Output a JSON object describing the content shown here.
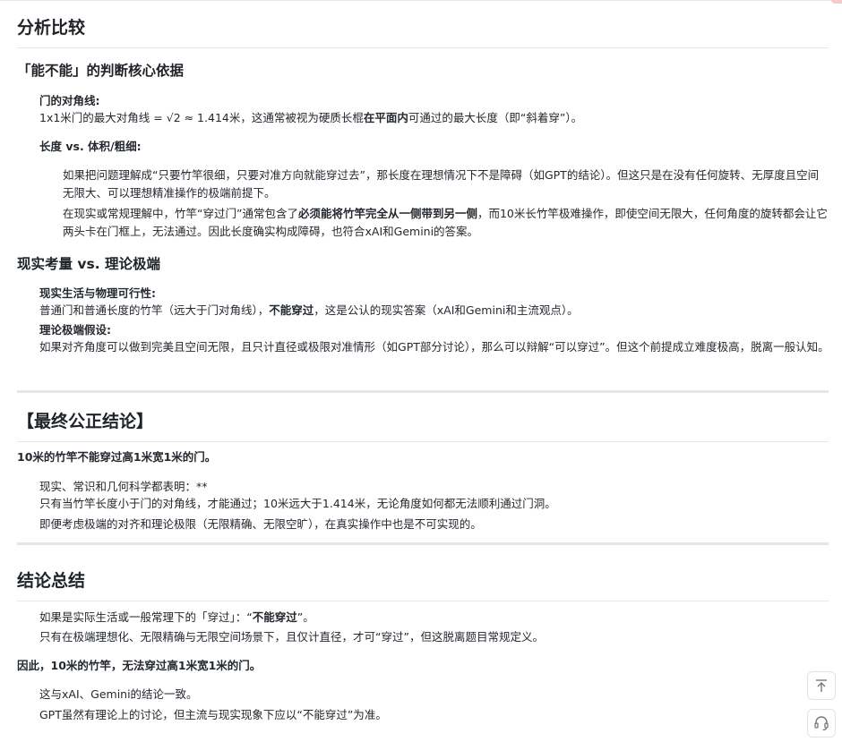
{
  "sections": {
    "analysis": {
      "title": "分析比较",
      "sub1": {
        "title": "「能不能」的判断核心依据",
        "diag_label": "门的对角线:",
        "diag_text_pre": "1x1米门的最大对角线 = √2 ≈ 1.414米，这通常被视为硬质长棍",
        "diag_text_bold": "在平面内",
        "diag_text_post": "可通过的最大长度（即“斜着穿”）。",
        "len_label": "长度 vs. 体积/粗细:",
        "len_p1": "如果把问题理解成“只要竹竿很细，只要对准方向就能穿过去”，那长度在理想情况下不是障碍（如GPT的结论）。但这只是在没有任何旋转、无厚度且空间无限大、可以理想精准操作的极端前提下。",
        "len_p2_pre": "在现实或常规理解中，竹竿“穿过门”通常包含了",
        "len_p2_bold": "必须能将竹竿完全从一侧带到另一侧",
        "len_p2_post": "，而10米长竹竿极难操作，即使空间无限大，任何角度的旋转都会让它两头卡在门框上，无法通过。因此长度确实构成障碍，也符合xAI和Gemini的答案。"
      },
      "sub2": {
        "title": "现实考量 vs. 理论极端",
        "real_label": "现实生活与物理可行性:",
        "real_text_pre": "普通门和普通长度的竹竿（远大于门对角线），",
        "real_text_bold": "不能穿过",
        "real_text_post": "，这是公认的现实答案（xAI和Gemini和主流观点）。",
        "theory_label": "理论极端假设:",
        "theory_text": "如果对齐角度可以做到完美且空间无限，且只计直径或极限对准情形（如GPT部分讨论），那么可以辩解“可以穿过”。但这个前提成立难度极高，脱离一般认知。"
      }
    },
    "final": {
      "title": "【最终公正结论】",
      "lead": "10米的竹竿不能穿过高1米宽1米的门。",
      "line1": "现实、常识和几何科学都表明：**",
      "line2": "只有当竹竿长度小于门的对角线，才能通过；10米远大于1.414米，无论角度如何都无法顺利通过门洞。",
      "line3": "即便考虑极端的对齐和理论极限（无限精确、无限空旷），在真实操作中也是不可实现的。"
    },
    "summary": {
      "title": "结论总结",
      "line1_pre": "如果是实际生活或一般常理下的「穿过」：“",
      "line1_bold": "不能穿过",
      "line1_post": "”。",
      "line2": "只有在极端理想化、无限精确与无限空间场景下，且仅计直径，才可“穿过”，但这脱离题目常规定义。",
      "lead": "因此，10米的竹竿，无法穿过高1米宽1米的门。",
      "line3": "这与xAI、Gemini的结论一致。",
      "line4": "GPT虽然有理论上的讨论，但主流与现实现象下应以“不能穿过”为准。"
    }
  },
  "floating": {
    "top_icon": "arrow-up-to-line-icon",
    "support_icon": "headset-icon"
  }
}
